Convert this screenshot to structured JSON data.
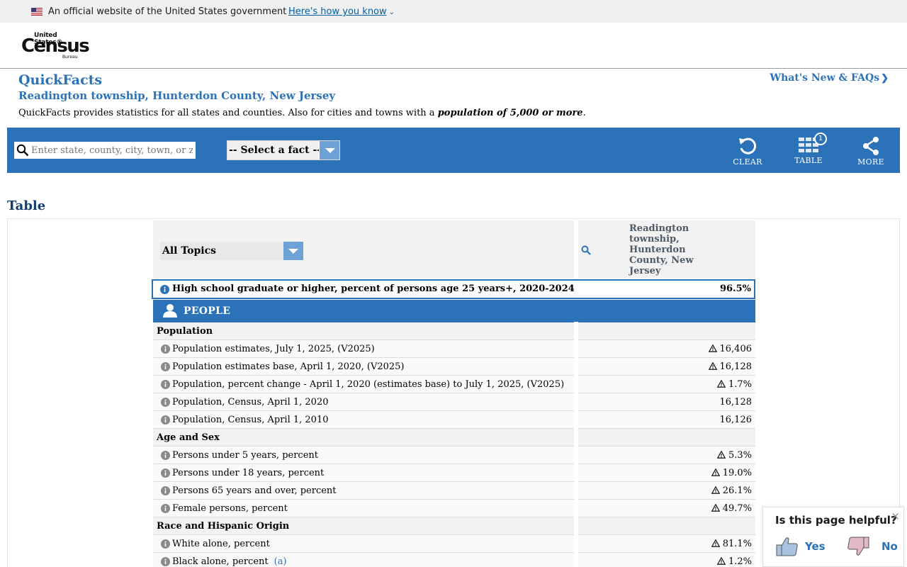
{
  "gov_banner": {
    "text": "An official website of the United States government",
    "link": "Here's how you know"
  },
  "logo": {
    "top": "United States®",
    "main": "Census",
    "bottom": "Bureau"
  },
  "header": {
    "title": "QuickFacts",
    "subtitle": "Readington township, Hunterdon County, New Jersey",
    "desc_prefix": "QuickFacts provides statistics for all states and counties. Also for cities and towns with a ",
    "desc_emph": "population of 5,000 or more",
    "desc_suffix": ".",
    "whats_new": "What's New & FAQs"
  },
  "toolbar": {
    "search_placeholder": "Enter state, county, city, town, or zip code",
    "select_fact": "-- Select a fact --",
    "clear": "CLEAR",
    "table": "TABLE",
    "table_badge": "1",
    "more": "MORE"
  },
  "table": {
    "heading": "Table",
    "topics_select": "All Topics",
    "geo_header": "Readington township, Hunterdon County, New Jersey",
    "highlight": {
      "label": "High school graduate or higher, percent of persons age 25 years+, 2020-2024",
      "value": "96.5%"
    },
    "section": "PEOPLE",
    "rows": [
      {
        "type": "cat",
        "label": "Population"
      },
      {
        "type": "fact",
        "label": "Population estimates, July 1, 2025, (V2025)",
        "value": "16,406",
        "flag": true
      },
      {
        "type": "fact",
        "label": "Population estimates base, April 1, 2020, (V2025)",
        "value": "16,128",
        "flag": true
      },
      {
        "type": "fact",
        "label": "Population, percent change - April 1, 2020 (estimates base) to July 1, 2025, (V2025)",
        "value": "1.7%",
        "flag": true
      },
      {
        "type": "fact",
        "label": "Population, Census, April 1, 2020",
        "value": "16,128",
        "flag": false
      },
      {
        "type": "fact",
        "label": "Population, Census, April 1, 2010",
        "value": "16,126",
        "flag": false
      },
      {
        "type": "cat",
        "label": "Age and Sex"
      },
      {
        "type": "fact",
        "label": "Persons under 5 years, percent",
        "value": "5.3%",
        "flag": true
      },
      {
        "type": "fact",
        "label": "Persons under 18 years, percent",
        "value": "19.0%",
        "flag": true
      },
      {
        "type": "fact",
        "label": "Persons 65 years and over, percent",
        "value": "26.1%",
        "flag": true
      },
      {
        "type": "fact",
        "label": "Female persons, percent",
        "value": "49.7%",
        "flag": true
      },
      {
        "type": "cat",
        "label": "Race and Hispanic Origin"
      },
      {
        "type": "fact",
        "label": "White alone, percent",
        "value": "81.1%",
        "flag": true
      },
      {
        "type": "fact",
        "label": "Black alone, percent",
        "note": "(a)",
        "value": "1.2%",
        "flag": true
      }
    ]
  },
  "feedback": {
    "question": "Is this page helpful?",
    "yes": "Yes",
    "no": "No",
    "close": "×"
  }
}
